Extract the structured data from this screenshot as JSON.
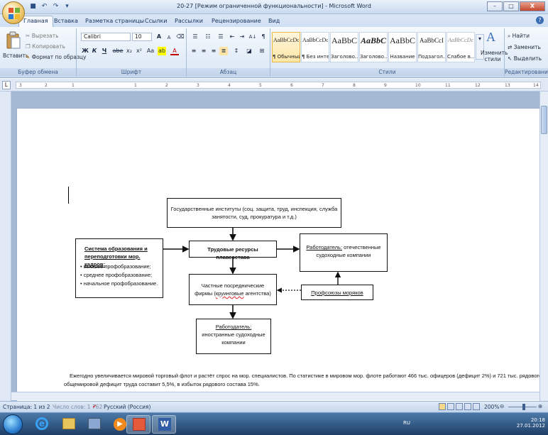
{
  "window": {
    "title": "20-27 [Режим ограниченной функциональности] - Microsoft Word"
  },
  "qat": {
    "undo": "↶",
    "redo": "↷",
    "more": "▾"
  },
  "window_controls": {
    "minimize": "–",
    "maximize": "□",
    "close": "X"
  },
  "tabs": [
    "Главная",
    "Вставка",
    "Разметка страницы",
    "Ссылки",
    "Рассылки",
    "Рецензирование",
    "Вид"
  ],
  "help": "?",
  "clipboard": {
    "paste": "Вставить",
    "cut": "Вырезать",
    "copy": "Копировать",
    "format_painter": "Формат по образцу",
    "label": "Буфер обмена"
  },
  "font": {
    "name": "Calibri",
    "size": "10",
    "label": "Шрифт",
    "bold": "Ж",
    "italic": "К",
    "underline": "Ч",
    "strike": "abe",
    "sub": "x₂",
    "sup": "x²",
    "case": "Aa",
    "grow": "A",
    "shrink": "A"
  },
  "paragraph": {
    "label": "Абзац",
    "sort": "A↓",
    "pilcrow": "¶"
  },
  "styles": {
    "label": "Стили",
    "items": [
      {
        "sample": "AaBbCcDc",
        "name": "¶ Обычный"
      },
      {
        "sample": "AaBbCcDc",
        "name": "¶ Без инте..."
      },
      {
        "sample": "AaBbC",
        "name": "Заголово..."
      },
      {
        "sample": "AaBbC",
        "name": "Заголово..."
      },
      {
        "sample": "AaBbC",
        "name": "Название"
      },
      {
        "sample": "AaBbCcI",
        "name": "Подзагол..."
      },
      {
        "sample": "AaBbCcDc",
        "name": "Слабое в..."
      }
    ],
    "change": "Изменить стили"
  },
  "editing": {
    "label": "Редактирование",
    "find": "Найти",
    "replace": "Заменить",
    "select": "Выделить"
  },
  "ruler": {
    "ticks": [
      "3",
      "2",
      "1",
      "1",
      "2",
      "3",
      "4",
      "5",
      "6",
      "7",
      "8",
      "9",
      "10",
      "11",
      "12",
      "13",
      "14"
    ]
  },
  "diagram": {
    "gov": "Государственные институты (соц. защита, труд, инспекция, служба занятости, суд, прокуратура и т.д.)",
    "edu_title": "Система образования и переподготовки мор. кадров:",
    "edu_items": [
      "высшее профобразование;",
      "среднее профобразование;",
      "начальное профобразование."
    ],
    "center": "Трудовые ресурсы плавсостава",
    "employer_dom": "Работодатель: отечественные судоходные компании",
    "employer_dom_u": "Работодатель:",
    "employer_dom_rest": " отечественные судоходные компании",
    "agents": "Частные посреднические фирмы (круинговые агентства)",
    "agents_a": "Частные посреднические фирмы (",
    "agents_b": "круинговые",
    "agents_c": " агентства)",
    "unions": "Профсоюзы моряков",
    "employer_for_u": "Работодатель:",
    "employer_for_rest": "иностранные судоходные компании"
  },
  "body": {
    "line1": "Ежегодно увеличивается мировой торговый флот и растёт спрос на мор. специалистов. По статистике в мировом мор. флоте работают 466 тыс. офицеров (дефицит 2%) и 721 тыс. рядового состава (избыток",
    "line2": "общемировой дефицит труда составит 5,5%, в избыток рядового состава 15%."
  },
  "status": {
    "page": "Страница: 1 из 2",
    "words": "Число слов: 1 762",
    "lang": "Русский (Россия)",
    "zoom": "200%"
  },
  "taskbar": {
    "lang": "RU",
    "time": "20:18",
    "date": "27.01.2012"
  }
}
